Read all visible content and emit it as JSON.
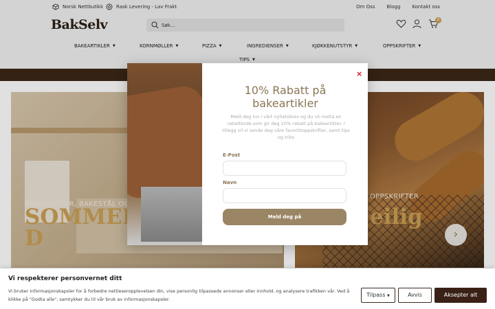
{
  "topbar": {
    "usp1": "Norsk Nettbutikk",
    "usp2": "Rask Levering - Lav Frakt",
    "links": [
      "Om Oss",
      "Blogg",
      "Kontakt oss"
    ]
  },
  "header": {
    "logo": "BakSelv",
    "search_placeholder": "Søk...",
    "cart_count": "0"
  },
  "nav": {
    "items": [
      "BAKEARTIKLER",
      "KORNMØLLER",
      "PIZZA",
      "INGREDIENSER",
      "KJØKKENUTSTYR",
      "OPPSKRIFTER",
      "TIPS"
    ]
  },
  "hero": {
    "left_kicker": "BRØDGRYTER, BAKESTÅL OG BAK",
    "left_title_line1": "SOMMER",
    "left_title_line2": "D",
    "right_kicker": "OPPSKRIFTER",
    "right_title": "eilig"
  },
  "modal": {
    "close": "×",
    "title": "10% Rabatt på bakeartikler",
    "description": "Meld deg inn i vårt nyhetsbrev og du vil motta en rabattkode som gir deg 10% rabatt på bakeartikler. I tillegg vil vi sende deg våre favorittoppskrifter, samt tips og triks",
    "email_label": "E-Post",
    "name_label": "Navn",
    "submit_label": "Meld deg på"
  },
  "cookie": {
    "title": "Vi respekterer personvernet ditt",
    "text": "Vi bruker informasjonskapsler for å forbedre nettleseropplevelsen din, vise personlig tilpassede annonser eller innhold, og analysere trafikken vår. Ved å klikke på \"Godta alle\", samtykker du til vår bruk av informasjonskapsler.",
    "customize": "Tilpass",
    "reject": "Avvis",
    "accept": "Aksepter alt"
  },
  "colors": {
    "accent": "#9a8565",
    "dark_brown": "#3a2116",
    "close_red": "#d1141a"
  }
}
